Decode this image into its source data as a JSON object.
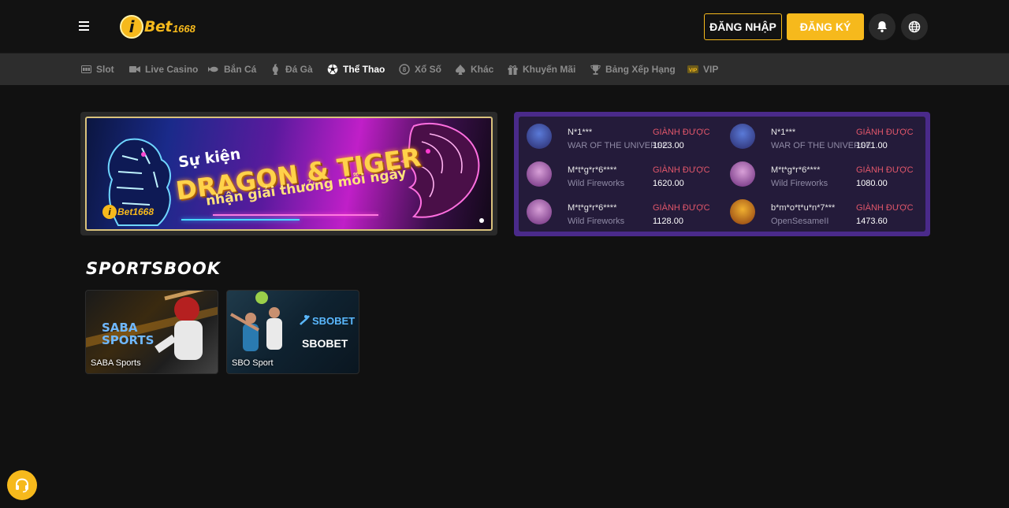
{
  "header": {
    "logo_text": "Bet",
    "logo_letter": "i",
    "logo_number": "1668",
    "login_label": "ĐĂNG NHẬP",
    "register_label": "ĐĂNG KÝ"
  },
  "nav": {
    "items": [
      {
        "label": "Slot",
        "icon": "slot-icon"
      },
      {
        "label": "Live Casino",
        "icon": "camera-icon"
      },
      {
        "label": "Bắn Cá",
        "icon": "fish-icon"
      },
      {
        "label": "Đá Gà",
        "icon": "rooster-icon"
      },
      {
        "label": "Thể Thao",
        "icon": "soccer-ball-icon",
        "active": true
      },
      {
        "label": "Xổ Số",
        "icon": "lottery-icon"
      },
      {
        "label": "Khác",
        "icon": "spade-icon"
      },
      {
        "label": "Khuyến Mãi",
        "icon": "gift-icon"
      },
      {
        "label": "Bảng Xếp Hạng",
        "icon": "trophy-icon"
      },
      {
        "label": "VIP",
        "icon": "vip-icon"
      }
    ]
  },
  "banner": {
    "subtitle": "Sự kiện",
    "title": "DRAGON & TIGER",
    "tagline": "nhận giải thưởng mỗi ngày",
    "logo_letter": "i",
    "logo_text": "Bet1668"
  },
  "winners": [
    {
      "name": "N*1***",
      "game": "WAR OF THE UNIVERSE",
      "label": "GIÀNH ĐƯỢC",
      "amount": "1023.00"
    },
    {
      "name": "N*1***",
      "game": "WAR OF THE UNIVERSE",
      "label": "GIÀNH ĐƯỢC",
      "amount": "1071.00"
    },
    {
      "name": "M*t*g*r*6****",
      "game": "Wild Fireworks",
      "label": "GIÀNH ĐƯỢC",
      "amount": "1620.00"
    },
    {
      "name": "M*t*g*r*6****",
      "game": "Wild Fireworks",
      "label": "GIÀNH ĐƯỢC",
      "amount": "1080.00"
    },
    {
      "name": "M*t*g*r*6****",
      "game": "Wild Fireworks",
      "label": "GIÀNH ĐƯỢC",
      "amount": "1128.00"
    },
    {
      "name": "b*m*o*t*u*n*7***",
      "game": "OpenSesameII",
      "label": "GIÀNH ĐƯỢC",
      "amount": "1473.60"
    }
  ],
  "sportsbook": {
    "title": "SPORTSBOOK",
    "cards": [
      {
        "label": "SABA Sports",
        "brand_top": "SABA",
        "brand_bottom": "SPORTS"
      },
      {
        "label": "SBO Sport",
        "brand_top": "SBOBET",
        "brand_bottom": "SBOBET"
      }
    ]
  },
  "colors": {
    "accent": "#f6b91c",
    "background": "#111111",
    "navbar": "#2d2d2d",
    "winners_border": "#4a2a8a",
    "win_label": "#e0566a"
  }
}
